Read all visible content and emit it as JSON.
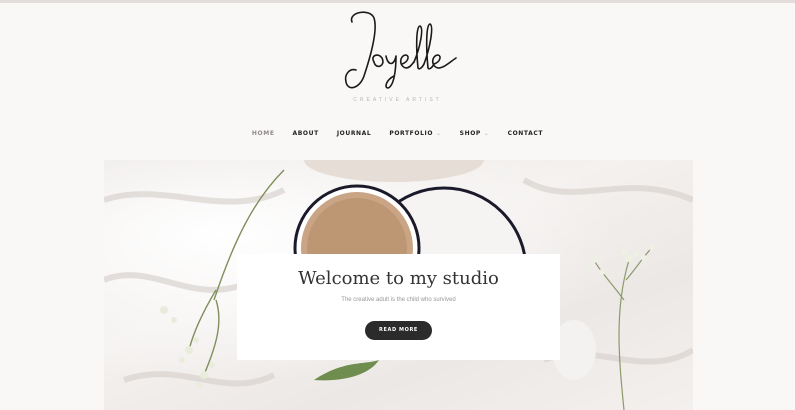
{
  "brand": {
    "tagline": "CREATIVE ARTIST"
  },
  "nav": {
    "items": [
      {
        "label": "HOME",
        "active": true,
        "has_dropdown": false
      },
      {
        "label": "ABOUT",
        "active": false,
        "has_dropdown": false
      },
      {
        "label": "JOURNAL",
        "active": false,
        "has_dropdown": false
      },
      {
        "label": "PORTFOLIO",
        "active": false,
        "has_dropdown": true
      },
      {
        "label": "SHOP",
        "active": false,
        "has_dropdown": true
      },
      {
        "label": "CONTACT",
        "active": false,
        "has_dropdown": false
      }
    ],
    "dropdown_icon": "chevron-down-icon"
  },
  "hero": {
    "title": "Welcome to my studio",
    "subtitle": "The creative adult is the child who survived",
    "button_label": "READ MORE"
  },
  "colors": {
    "background": "#faf8f7",
    "accent": "#e4dcdb",
    "button": "#2c2b2b",
    "text": "#333333"
  }
}
